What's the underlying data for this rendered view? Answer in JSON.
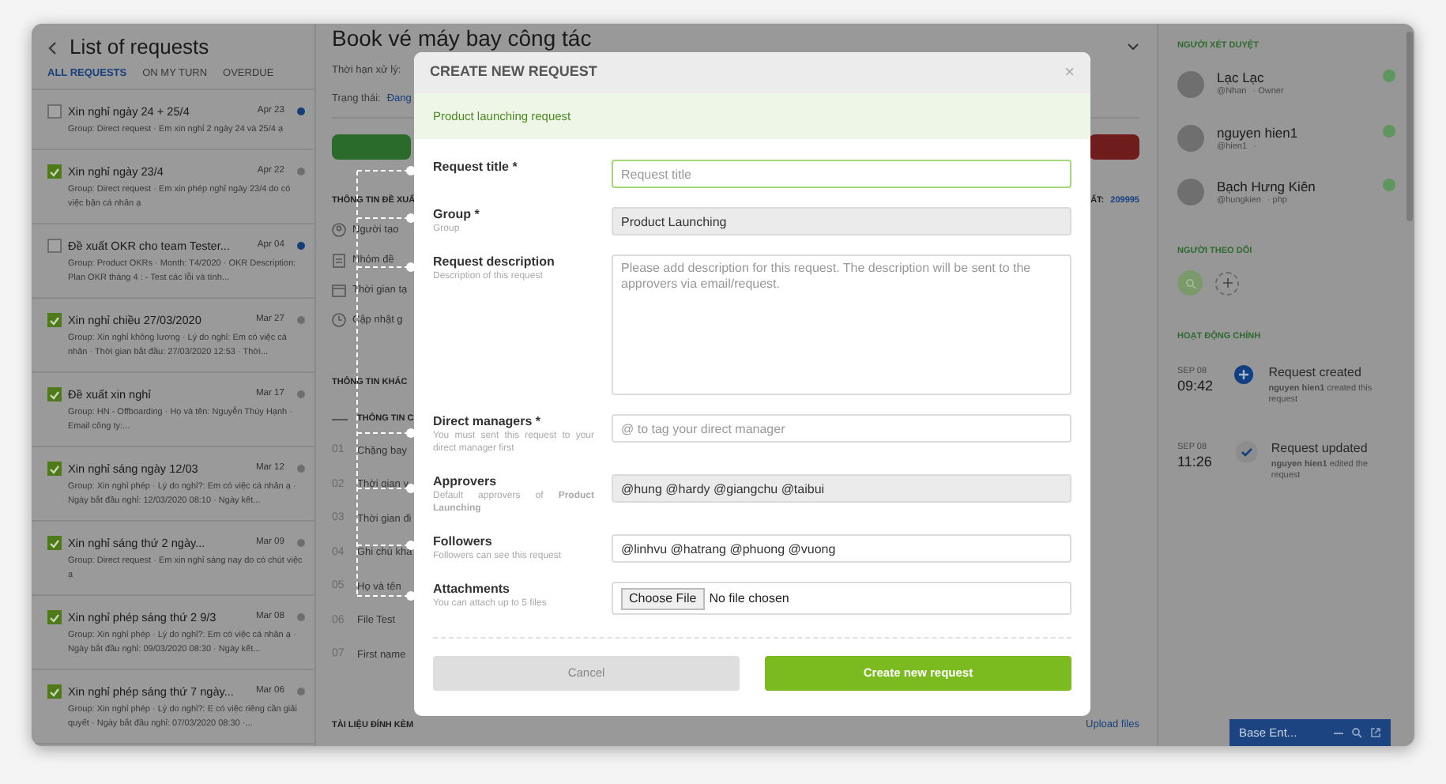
{
  "requests_panel": {
    "title": "List of requests",
    "tabs": [
      {
        "label": "ALL REQUESTS",
        "selected": true
      },
      {
        "label": "ON MY TURN",
        "selected": false
      },
      {
        "label": "OVERDUE",
        "selected": false
      }
    ],
    "requests": [
      {
        "title": "Xin nghỉ ngày 24 + 25/4",
        "date": "Apr 23",
        "checked": false,
        "color": "#163d78",
        "description": "Group: Direct request · Em xin nghỉ 2 ngày 24 và 25/4 ạ"
      },
      {
        "title": "Xin nghỉ ngày 23/4",
        "date": "Apr 22",
        "checked": true,
        "color": "#6e6e6e",
        "description": "Group: Direct request · Em xin phép nghỉ ngày 23/4 do có việc bận cá nhân ạ"
      },
      {
        "title": "Đề xuất OKR cho team Tester...",
        "date": "Apr 04",
        "checked": false,
        "color": "#163d78",
        "description": "Group: Product OKRs · Month: T4/2020 · OKR Description: Plan OKR tháng 4 : - Test các lỗi và tính..."
      },
      {
        "title": "Xin nghỉ chiều 27/03/2020",
        "date": "Mar 27",
        "checked": true,
        "color": "#6e6e6e",
        "description": "Group: Xin nghỉ không lương · Lý do nghỉ: Em có việc cá nhân · Thời gian bắt đầu: 27/03/2020 12:53 · Thời..."
      },
      {
        "title": "Đề xuất xin nghỉ",
        "date": "Mar 17",
        "checked": true,
        "color": "#6e6e6e",
        "description": "Group: HN - Offboarding · Họ và tên: Nguyễn Thúy Hạnh · Email công ty:..."
      },
      {
        "title": "Xin nghỉ sáng ngày 12/03",
        "date": "Mar 12",
        "checked": true,
        "color": "#6e6e6e",
        "description": "Group: Xin nghỉ phép · Lý do nghỉ?: Em có việc cá nhân ạ · Ngày bắt đầu nghỉ: 12/03/2020 08:10 · Ngày kết..."
      },
      {
        "title": "Xin nghỉ sáng thứ 2 ngày...",
        "date": "Mar 09",
        "checked": true,
        "color": "#6e6e6e",
        "description": "Group: Direct request · Em xin nghỉ sáng nay do có chút việc ạ"
      },
      {
        "title": "Xin nghỉ phép sáng thứ 2 9/3",
        "date": "Mar 08",
        "checked": true,
        "color": "#6e6e6e",
        "description": "Group: Xin nghỉ phép · Lý do nghỉ?: Em có việc cá nhân ạ · Ngày bắt đầu nghỉ: 09/03/2020 08:30 · Ngày kết..."
      },
      {
        "title": "Xin nghỉ phép sáng thứ 7 ngày...",
        "date": "Mar 06",
        "checked": true,
        "color": "#6e6e6e",
        "description": "Group: Xin nghỉ phép · Lý do nghỉ?: E có việc riêng cần giải quyết · Ngày bắt đầu nghỉ: 07/03/2020 08:30 ·..."
      }
    ]
  },
  "detail": {
    "title": "Book vé máy bay công tác",
    "deadline_label": "Thời hạn xử lý:",
    "status_label": "Trạng thái:",
    "status_value": "Đang",
    "id_label": "ẤT:",
    "id_value": "209995",
    "section_info": "THÔNG TIN ĐỀ XUẤ",
    "info_rows": [
      {
        "kind": "person",
        "label": "Người tạo"
      },
      {
        "kind": "clipboard",
        "label": "Nhóm đề"
      },
      {
        "kind": "calendar",
        "label": "Thời gian tạ"
      },
      {
        "kind": "clock",
        "label": "Cập nhật g"
      }
    ],
    "section_other": "THÔNG TIN KHÁC",
    "subsection": "THÔNG TIN C",
    "fields": [
      {
        "number": "01",
        "label": "Chặng bay"
      },
      {
        "number": "02",
        "label": "Thời gian v"
      },
      {
        "number": "03",
        "label": "Thời gian đi"
      },
      {
        "number": "04",
        "label": "Ghi chú khá"
      },
      {
        "number": "05",
        "label": "Họ và tên"
      },
      {
        "number": "06",
        "label": "File Test"
      },
      {
        "number": "07",
        "label": "First name"
      }
    ],
    "section_files": "TÀI LIỆU ĐÍNH KÈM",
    "upload_link": "Upload files"
  },
  "modal": {
    "title": "CREATE NEW REQUEST",
    "close": "×",
    "banner": "Product launching request",
    "fields": [
      {
        "kind": "input",
        "label": "Request title *",
        "placeholder": "Request title",
        "focused": true
      },
      {
        "kind": "readonly",
        "label": "Group *",
        "hint": "Group",
        "value": "Product Launching"
      },
      {
        "kind": "textarea",
        "label": "Request description",
        "hint": "Description of this request",
        "placeholder": "Please add description for this request. The description will be sent to the approvers via email/request."
      },
      {
        "kind": "input",
        "label": "Direct managers *",
        "hint": "You must sent this request to your direct manager first",
        "placeholder": "@ to tag your direct manager",
        "focused": false
      },
      {
        "kind": "readonly",
        "label": "Approvers",
        "hint": "Default approvers of **Product Launching**",
        "value": "@hung @hardy @giangchu @taibui"
      },
      {
        "kind": "input",
        "label": "Followers",
        "hint": "Followers can see this request",
        "value": "@linhvu @hatrang @phuong @vuong",
        "focused": false
      },
      {
        "kind": "file",
        "label": "Attachments",
        "hint": "You can attach up to 5 files",
        "button": "Choose File",
        "status": "No file chosen"
      }
    ],
    "buttons": [
      {
        "kind": "secondary",
        "label": "Cancel"
      },
      {
        "kind": "primary",
        "label": "Create new request"
      }
    ]
  },
  "side_panel": {
    "approvers_title": "NGƯỜI XÉT DUYỆT",
    "approvers": [
      {
        "name": "Lạc Lạc",
        "handle": "@Nhan",
        "role": "· Owner",
        "online": true
      },
      {
        "name": "nguyen hien1",
        "handle": "@hien1",
        "role": "·",
        "online": true
      },
      {
        "name": "Bạch Hưng Kiên",
        "handle": "@hungkien",
        "role": "· php",
        "online": true
      }
    ],
    "followers_title": "NGƯỜI THEO DÕI",
    "activity_title": "HOẠT ĐỘNG CHÍNH",
    "activities": [
      {
        "kind": "created",
        "date": "SEP 08",
        "time": "09:42",
        "title": "Request created",
        "text": "**nguyen hien1** created this request"
      },
      {
        "kind": "updated",
        "date": "SEP 08",
        "time": "11:26",
        "title": "Request updated",
        "text": "**nguyen hien1** edited the request"
      }
    ]
  },
  "chat_bar": {
    "title": "Base Ent..."
  }
}
